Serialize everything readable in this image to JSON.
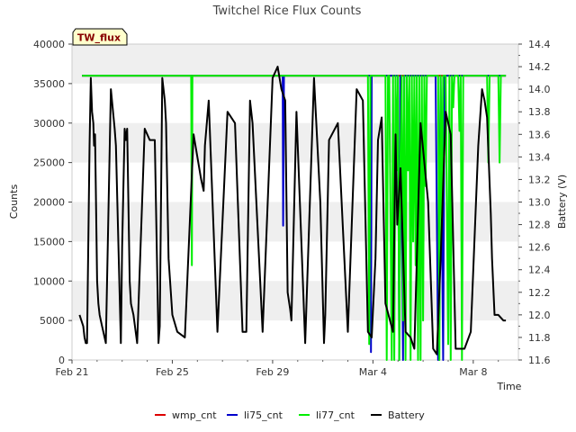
{
  "chart_data": {
    "type": "line",
    "title": "Twitchel Rice Flux Counts",
    "site_label": "TW_flux",
    "xlabel": "Time",
    "ylabel_left": "Counts",
    "ylabel_right": "Battery (V)",
    "x_unit": "days since Feb 21",
    "xlim": [
      0,
      17.8
    ],
    "ylim_left": [
      0,
      40000
    ],
    "ylim_right": [
      11.6,
      14.4
    ],
    "x_ticks": [
      {
        "value": 0,
        "label": "Feb 21"
      },
      {
        "value": 4,
        "label": "Feb 25"
      },
      {
        "value": 8,
        "label": "Feb 29"
      },
      {
        "value": 12,
        "label": "Mar 4"
      },
      {
        "value": 16,
        "label": "Mar 8"
      }
    ],
    "y_ticks_left": [
      0,
      5000,
      10000,
      15000,
      20000,
      25000,
      30000,
      35000,
      40000
    ],
    "y_ticks_right": [
      "11.6",
      "11.8",
      "12.0",
      "12.2",
      "12.4",
      "12.6",
      "12.8",
      "13.0",
      "13.2",
      "13.4",
      "13.6",
      "13.8",
      "14.0",
      "14.2",
      "14.4"
    ],
    "grid_bands": true,
    "legend_position": "bottom",
    "series": [
      {
        "name": "wmp_cnt",
        "color": "#dd0000",
        "axis": "left",
        "x": [
          0.4,
          12.0,
          12.1,
          13.3,
          13.5,
          14.2,
          14.3,
          17.3
        ],
        "y": [
          36000,
          36000,
          36000,
          36000,
          36000,
          36000,
          36000,
          36000
        ]
      },
      {
        "name": "li75_cnt",
        "color": "#0000cc",
        "axis": "left",
        "x": [
          0.4,
          8.4,
          8.42,
          8.45,
          8.5,
          11.9,
          11.92,
          11.95,
          12.0,
          13.0,
          13.05,
          13.1,
          13.2,
          13.25,
          13.3,
          14.5,
          14.6,
          14.7,
          14.8,
          14.85,
          14.9,
          15.0,
          17.3
        ],
        "y": [
          36000,
          36000,
          17000,
          36000,
          36000,
          36000,
          1000,
          36000,
          36000,
          36000,
          0,
          36000,
          0,
          36000,
          36000,
          36000,
          0,
          36000,
          0,
          36000,
          36000,
          36000,
          36000
        ]
      },
      {
        "name": "li77_cnt",
        "color": "#00ee00",
        "axis": "left",
        "x": [
          0.4,
          4.75,
          4.78,
          4.8,
          4.85,
          11.8,
          11.85,
          11.9,
          11.95,
          12.0,
          12.5,
          12.55,
          12.6,
          12.65,
          12.75,
          12.8,
          12.85,
          12.9,
          12.95,
          13.0,
          13.05,
          13.1,
          13.15,
          13.2,
          13.25,
          13.3,
          13.35,
          13.4,
          13.45,
          13.5,
          13.55,
          13.6,
          13.65,
          13.7,
          13.75,
          13.8,
          13.85,
          13.9,
          13.95,
          14.0,
          14.05,
          14.1,
          14.15,
          14.2,
          14.25,
          14.3,
          14.35,
          14.4,
          14.45,
          14.5,
          14.6,
          14.65,
          14.7,
          14.75,
          14.8,
          14.9,
          15.0,
          15.05,
          15.1,
          15.15,
          15.2,
          15.25,
          15.3,
          15.4,
          15.45,
          15.5,
          15.55,
          15.6,
          16.55,
          16.6,
          16.65,
          16.7,
          17.0,
          17.05,
          17.1,
          17.15,
          17.3
        ],
        "y": [
          36000,
          36000,
          12000,
          36000,
          36000,
          36000,
          2000,
          36000,
          36000,
          36000,
          36000,
          0,
          36000,
          36000,
          0,
          36000,
          0,
          36000,
          24000,
          36000,
          0,
          26000,
          36000,
          5000,
          36000,
          0,
          36000,
          24000,
          36000,
          0,
          36000,
          15000,
          36000,
          12000,
          36000,
          0,
          36000,
          0,
          36000,
          5000,
          36000,
          22000,
          36000,
          36000,
          36000,
          36000,
          36000,
          36000,
          36000,
          36000,
          36000,
          0,
          36000,
          18000,
          36000,
          36000,
          2000,
          36000,
          0,
          36000,
          32000,
          36000,
          36000,
          36000,
          29000,
          36000,
          0,
          36000,
          36000,
          25000,
          36000,
          36000,
          36000,
          25000,
          36000,
          36000,
          36000
        ]
      },
      {
        "name": "Battery",
        "color": "#000000",
        "axis": "right",
        "x": [
          0.3,
          0.45,
          0.5,
          0.55,
          0.6,
          0.7,
          0.75,
          0.8,
          0.85,
          0.88,
          0.92,
          0.95,
          1.0,
          1.05,
          1.1,
          1.2,
          1.35,
          1.55,
          1.7,
          1.75,
          1.95,
          2.0,
          2.1,
          2.15,
          2.2,
          2.3,
          2.35,
          2.45,
          2.6,
          2.9,
          3.1,
          3.3,
          3.45,
          3.5,
          3.6,
          3.7,
          3.75,
          3.85,
          4.0,
          4.2,
          4.5,
          4.85,
          5.0,
          5.15,
          5.25,
          5.3,
          5.45,
          5.8,
          6.2,
          6.5,
          6.8,
          6.95,
          7.1,
          7.2,
          7.6,
          8.0,
          8.2,
          8.35,
          8.5,
          8.6,
          8.7,
          8.75,
          8.95,
          9.3,
          9.65,
          9.9,
          10.05,
          10.1,
          10.25,
          10.6,
          11.0,
          11.35,
          11.6,
          11.8,
          11.95,
          12.1,
          12.2,
          12.35,
          12.5,
          12.8,
          12.9,
          12.97,
          13.1,
          13.3,
          13.5,
          13.65,
          13.9,
          14.2,
          14.4,
          14.55,
          14.7,
          14.9,
          15.1,
          15.3,
          15.65,
          15.9,
          16.2,
          16.35,
          16.45,
          16.55,
          16.7,
          16.75,
          16.85,
          17.0,
          17.2,
          17.3
        ],
        "y": [
          12.0,
          11.9,
          11.8,
          11.75,
          11.75,
          13.5,
          14.1,
          13.8,
          13.7,
          13.5,
          13.6,
          13.1,
          12.3,
          12.1,
          12.0,
          11.9,
          11.75,
          14.0,
          13.65,
          13.5,
          11.75,
          12.6,
          13.65,
          13.55,
          13.65,
          12.3,
          12.1,
          12.0,
          11.75,
          13.65,
          13.55,
          13.55,
          11.75,
          11.9,
          14.1,
          13.9,
          13.7,
          12.5,
          12.0,
          11.85,
          11.8,
          13.6,
          13.4,
          13.2,
          13.1,
          13.5,
          13.9,
          11.85,
          13.8,
          13.7,
          11.85,
          11.85,
          13.9,
          13.7,
          11.85,
          14.1,
          14.2,
          14.0,
          13.9,
          12.2,
          12.05,
          11.95,
          13.8,
          11.75,
          14.1,
          13.0,
          11.75,
          12.0,
          13.55,
          13.7,
          11.85,
          14.0,
          13.9,
          11.85,
          11.8,
          12.5,
          13.55,
          13.75,
          12.1,
          11.85,
          13.6,
          12.8,
          13.3,
          11.85,
          11.8,
          11.7,
          13.7,
          13.0,
          11.7,
          11.65,
          12.5,
          13.8,
          13.6,
          11.7,
          11.7,
          11.85,
          13.5,
          14.0,
          13.9,
          13.75,
          12.9,
          12.5,
          12.0,
          12.0,
          11.95,
          11.95
        ]
      }
    ]
  }
}
